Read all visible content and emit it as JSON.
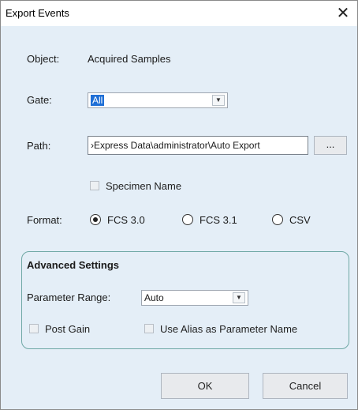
{
  "window": {
    "title": "Export Events",
    "close_glyph": "✕"
  },
  "object": {
    "label": "Object:",
    "value": "Acquired Samples"
  },
  "gate": {
    "label": "Gate:",
    "selected": "All"
  },
  "path": {
    "label": "Path:",
    "value": "›Express Data\\administrator\\Auto Export",
    "browse_label": "..."
  },
  "specimen_name": {
    "label": "Specimen Name",
    "checked": false
  },
  "format": {
    "label": "Format:",
    "options": [
      {
        "label": "FCS 3.0",
        "selected": true
      },
      {
        "label": "FCS 3.1",
        "selected": false
      },
      {
        "label": "CSV",
        "selected": false
      }
    ]
  },
  "advanced": {
    "title": "Advanced Settings",
    "parameter_range_label": "Parameter Range:",
    "parameter_range_value": "Auto",
    "post_gain_label": "Post Gain",
    "use_alias_label": "Use Alias as Parameter Name"
  },
  "buttons": {
    "ok": "OK",
    "cancel": "Cancel"
  },
  "colors": {
    "dialog_background": "#e4eef7",
    "selection": "#1f6fd6",
    "group_border": "#6fa8a5"
  }
}
